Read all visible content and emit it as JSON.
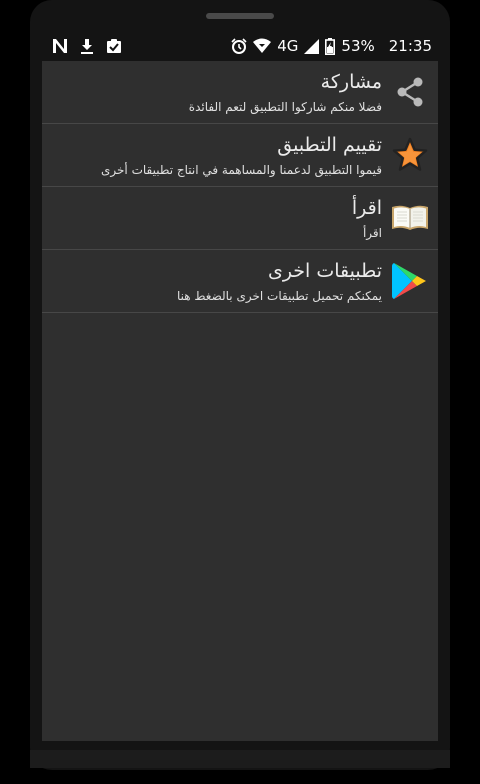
{
  "status_bar": {
    "battery_percent": "53%",
    "time": "21:35",
    "network": "4G",
    "icons_left": [
      "n-icon",
      "download-icon",
      "clipboard-check-icon"
    ],
    "icons_right": [
      "alarm-icon",
      "wifi-icon",
      "signal-icon",
      "battery-icon"
    ]
  },
  "menu": {
    "items": [
      {
        "title": "مشاركة",
        "subtitle": "فضلا منكم شاركوا التطبيق لتعم الفائدة",
        "icon": "share-icon"
      },
      {
        "title": "تقييم التطبيق",
        "subtitle": "قيموا التطبيق لدعمنا والمساهمة في انتاج تطبيقات أخرى",
        "icon": "star-icon"
      },
      {
        "title": "اقرأ",
        "subtitle": "اقرأ",
        "icon": "book-icon"
      },
      {
        "title": "تطبيقات اخرى",
        "subtitle": "يمكنكم تحميل تطبيقات اخرى بالضغط هنا",
        "icon": "play-store-icon"
      }
    ]
  },
  "colors": {
    "background": "#2f2f2f",
    "divider": "#474747",
    "star_orange": "#f07d1e"
  }
}
